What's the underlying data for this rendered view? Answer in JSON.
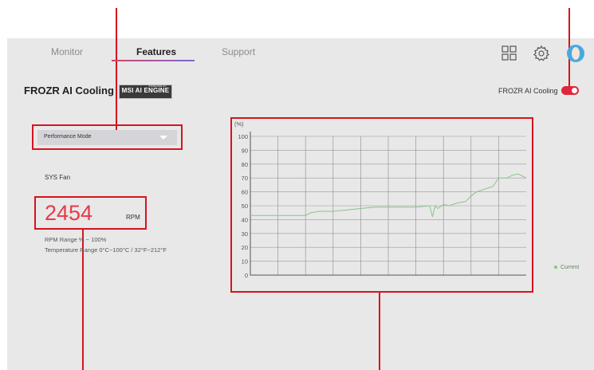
{
  "nav": {
    "tabs": [
      {
        "label": "Monitor"
      },
      {
        "label": "Features"
      },
      {
        "label": "Support"
      }
    ],
    "icons": [
      "grid-icon",
      "gear-icon",
      "avatar"
    ]
  },
  "header": {
    "title": "FROZR AI Cooling",
    "badge_small": "POWERED BY",
    "badge": "MSI AI ENGINE",
    "toggle_label": "FROZR AI Cooling",
    "toggle_on": true
  },
  "mode_select": {
    "value": "Performance Mode"
  },
  "fan": {
    "name": "SYS Fan",
    "rpm": "2454",
    "unit": "RPM",
    "rpm_range": "RPM Range  % ~ 100%",
    "temp_range": "Temperature Range  0°C~100°C / 32°F~212°F"
  },
  "colors": {
    "accent": "#e0263a",
    "annotation": "#d5141f",
    "line": "#8ac48a"
  },
  "chart_data": {
    "type": "line",
    "ylabel": "(%)",
    "ylim": [
      0,
      100
    ],
    "yticks": [
      100,
      90,
      80,
      70,
      60,
      50,
      40,
      30,
      20,
      10,
      0
    ],
    "grid": true,
    "legend_position": "right",
    "series": [
      {
        "name": "Current",
        "x": [
          0,
          5,
          10,
          15,
          20,
          22,
          25,
          28,
          30,
          35,
          40,
          45,
          50,
          55,
          60,
          65,
          66,
          67,
          68,
          70,
          72,
          75,
          78,
          80,
          82,
          85,
          88,
          90,
          93,
          95,
          97,
          100
        ],
        "values": [
          43,
          43,
          43,
          43,
          43,
          45,
          46,
          46,
          46,
          47,
          48,
          49,
          49,
          49,
          49,
          50,
          42,
          50,
          48,
          51,
          50,
          52,
          53,
          57,
          60,
          62,
          64,
          70,
          70,
          72,
          73,
          70
        ]
      }
    ]
  }
}
